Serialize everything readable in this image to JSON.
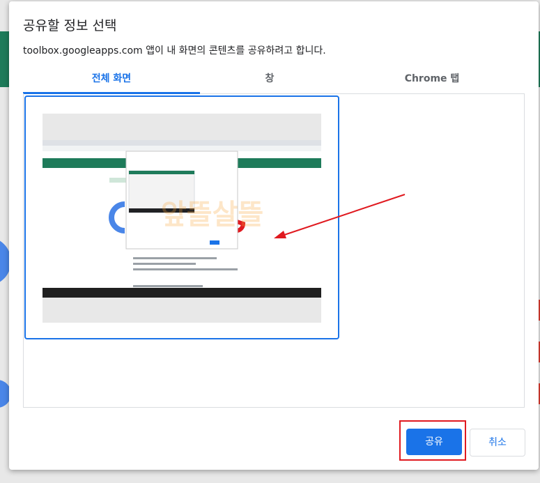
{
  "dialog": {
    "title": "공유할 정보 선택",
    "subtitle": "toolbox.googleapps.com 앱이 내 화면의 콘텐츠를 공유하려고 합니다.",
    "tabs": [
      {
        "label": "전체 화면",
        "active": true
      },
      {
        "label": "창",
        "active": false
      },
      {
        "label": "Chrome 탭",
        "active": false
      }
    ],
    "buttons": {
      "share": "공유",
      "cancel": "취소"
    }
  },
  "colors": {
    "accent": "#1a73e8",
    "annotation_red": "#e0191f",
    "brand_green": "#1e7b5a"
  }
}
